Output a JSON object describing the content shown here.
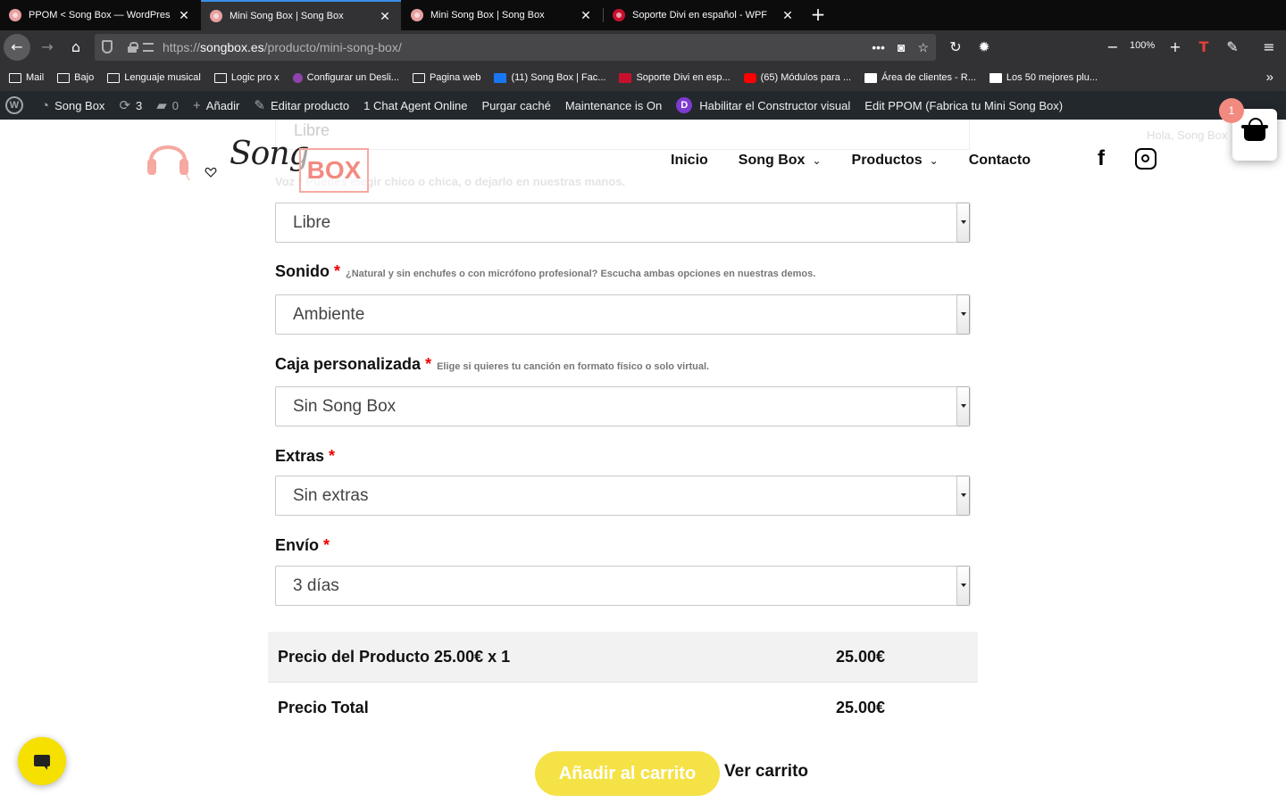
{
  "browser": {
    "tabs": [
      {
        "title": "PPOM < Song Box — WordPres",
        "active": false
      },
      {
        "title": "Mini Song Box | Song Box",
        "active": true
      },
      {
        "title": "Mini Song Box | Song Box",
        "active": false
      },
      {
        "title": "Soporte Divi en español - WPF",
        "active": false
      }
    ],
    "url_scheme": "https://",
    "url_host": "songbox.es",
    "url_path": "/producto/mini-song-box/",
    "zoom": "100%",
    "bookmarks": [
      {
        "label": "Mail",
        "icon": "folder-icon"
      },
      {
        "label": "Bajo",
        "icon": "folder-icon"
      },
      {
        "label": "Lenguaje musical",
        "icon": "folder-icon"
      },
      {
        "label": "Logic pro x",
        "icon": "folder-icon"
      },
      {
        "label": "Configurar un Desli...",
        "icon": "purple-app-icon"
      },
      {
        "label": "Pagina web",
        "icon": "folder-icon"
      },
      {
        "label": "(11) Song Box | Fac...",
        "icon": "facebook-icon"
      },
      {
        "label": "Soporte Divi en esp...",
        "icon": "wpf-icon"
      },
      {
        "label": "(65) Módulos para ...",
        "icon": "youtube-icon"
      },
      {
        "label": "Área de clientes - R...",
        "icon": "site-icon"
      },
      {
        "label": "Los 50 mejores plu...",
        "icon": "wordpress-icon"
      }
    ]
  },
  "adminbar": {
    "site_name": "Song Box",
    "updates": "3",
    "comments": "0",
    "add": "Añadir",
    "edit_product": "Editar producto",
    "chat": "1 Chat Agent Online",
    "purge": "Purgar caché",
    "maintenance": "Maintenance is On",
    "divi_builder": "Habilitar el Constructor visual",
    "edit_ppom": "Edit PPOM (Fabrica tu Mini Song Box)"
  },
  "header": {
    "logo_script": "Song",
    "logo_box": "BOX",
    "nav": [
      {
        "label": "Inicio",
        "dropdown": false
      },
      {
        "label": "Song Box",
        "dropdown": true
      },
      {
        "label": "Productos",
        "dropdown": true
      },
      {
        "label": "Contacto",
        "dropdown": false
      }
    ],
    "greeting": "Hola, Song Box",
    "ghost_select_value": "Libre",
    "ghost_label": "Voz * Puedes elegir chico o chica, o dejarlo en nuestras manos."
  },
  "cart": {
    "count": "1"
  },
  "form": {
    "voz_value": "Libre",
    "sonido": {
      "label": "Sonido",
      "hint": "¿Natural y sin enchufes o con micrófono profesional? Escucha ambas opciones en nuestras demos.",
      "value": "Ambiente"
    },
    "caja": {
      "label": "Caja personalizada",
      "hint": "Elige si quieres tu canción en formato físico o solo virtual.",
      "value": "Sin Song Box"
    },
    "extras": {
      "label": "Extras",
      "hint": "",
      "value": "Sin extras"
    },
    "envio": {
      "label": "Envío",
      "hint": "",
      "value": "3 días"
    },
    "required_mark": "*"
  },
  "prices": {
    "product_label": "Precio del Producto 25.00€ x 1",
    "product_value": "25.00€",
    "total_label": "Precio Total",
    "total_value": "25.00€"
  },
  "actions": {
    "add_to_cart": "Añadir al carrito",
    "view_cart": "Ver carrito"
  },
  "colors": {
    "brand_pink": "#f28a80",
    "button_yellow": "#f5e246",
    "required_red": "#e00000"
  }
}
